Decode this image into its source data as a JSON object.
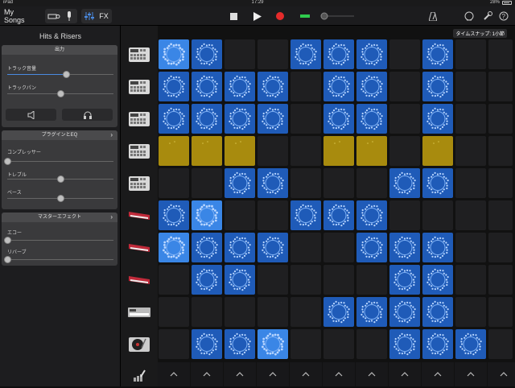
{
  "status": {
    "device": "iPad",
    "time": "17:29",
    "battery": "28%"
  },
  "toolbar": {
    "back": "My Songs",
    "fx": "FX"
  },
  "sidebar": {
    "title": "Hits & Risers",
    "output": {
      "header": "出力",
      "volume_label": "トラック音量",
      "pan_label": "トラックパン",
      "volume": 0.55,
      "pan": 0.5
    },
    "plugins": {
      "header": "プラグインとEQ",
      "compressor": "コンプレッサー",
      "treble": "トレブル",
      "bass": "ベース",
      "compressor_val": 0.0,
      "treble_val": 0.5,
      "bass_val": 0.5
    },
    "master": {
      "header": "マスターエフェクト",
      "echo": "エコー",
      "reverb": "リバーブ",
      "echo_val": 0.0,
      "reverb_val": 0.0
    }
  },
  "snap_label": "タイムスナップ: 1小節",
  "instruments": [
    "drum-machine-icon",
    "drum-machine-icon",
    "drum-machine-icon",
    "drum-machine-icon",
    "drum-machine-icon",
    "keyboard-icon",
    "keyboard-icon",
    "keyboard-icon",
    "sampler-icon",
    "turntable-icon"
  ],
  "rows": [
    [
      "L",
      "B",
      ".",
      ".",
      "B",
      "B",
      "B",
      ".",
      "B",
      "."
    ],
    [
      "B",
      "B",
      "B",
      "B",
      ".",
      "B",
      "B",
      ".",
      "B",
      "."
    ],
    [
      "B",
      "B",
      "B",
      "B",
      ".",
      "B",
      "B",
      ".",
      "B",
      "."
    ],
    [
      "G",
      "G",
      "G",
      ".",
      ".",
      "G",
      "G",
      ".",
      "G",
      "."
    ],
    [
      ".",
      ".",
      "B",
      "B",
      ".",
      ".",
      ".",
      "B",
      "B",
      "."
    ],
    [
      "B",
      "L",
      ".",
      ".",
      "B",
      "B",
      "B",
      ".",
      ".",
      "."
    ],
    [
      "L",
      "B",
      "B",
      "B",
      ".",
      ".",
      "B",
      "B",
      "B",
      "."
    ],
    [
      ".",
      "B",
      "B",
      ".",
      ".",
      ".",
      ".",
      "B",
      "B",
      "."
    ],
    [
      ".",
      ".",
      ".",
      ".",
      ".",
      "B",
      "B",
      "B",
      "B",
      "."
    ],
    [
      ".",
      "B",
      "B",
      "L",
      ".",
      ".",
      ".",
      "B",
      "B",
      "B"
    ]
  ]
}
